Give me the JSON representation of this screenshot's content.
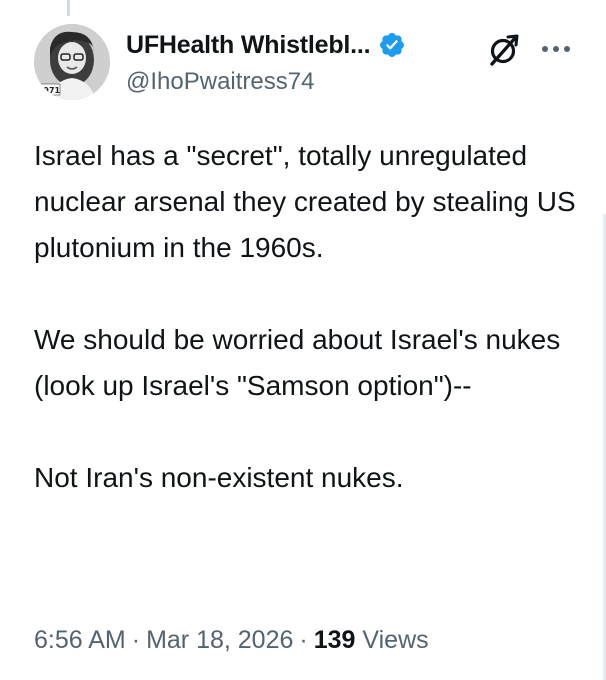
{
  "tweet": {
    "author": {
      "display_name": "UFHealth Whistlebl...",
      "handle": "@IhoPwaitress74",
      "verified": true,
      "avatar_badge": "1971"
    },
    "icons": {
      "verified": "verified-badge-icon",
      "grok": "grok-icon",
      "more": "more-options-icon"
    },
    "paragraphs": [
      "Israel has a \"secret\", totally unregulated nuclear arsenal they created by stealing US plutonium in the 1960s.",
      "We should be worried about Israel's nukes (look up Israel's \"Samson option\")--",
      "Not Iran's non-existent nukes."
    ],
    "time": "6:56 AM",
    "date": "Mar 18, 2026",
    "separator": "·",
    "views_count": "139",
    "views_label": "Views"
  },
  "colors": {
    "text": "#0f1419",
    "muted": "#536471",
    "verified_blue": "#1d9bf0"
  }
}
